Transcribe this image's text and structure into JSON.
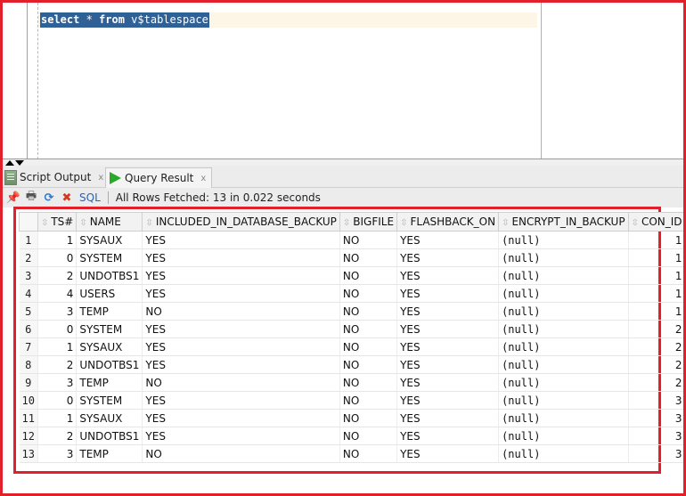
{
  "editor": {
    "sql_keyword_select": "select",
    "sql_star": " * ",
    "sql_keyword_from": "from",
    "sql_object": " v$tablespace"
  },
  "tabs": [
    {
      "label": "Script Output",
      "close": "x",
      "icon": "script-output-icon"
    },
    {
      "label": "Query Result",
      "close": "x",
      "icon": "play-icon",
      "active": true
    }
  ],
  "toolbar": {
    "pin_icon": "📌",
    "print_icon": "🖶",
    "refresh_icon": "⟳",
    "cancel_icon": "✖",
    "sql_label": "SQL",
    "status": "All Rows Fetched: 13 in 0.022 seconds"
  },
  "grid": {
    "sort_glyph": "⇳",
    "columns": [
      "TS#",
      "NAME",
      "INCLUDED_IN_DATABASE_BACKUP",
      "BIGFILE",
      "FLASHBACK_ON",
      "ENCRYPT_IN_BACKUP",
      "CON_ID"
    ],
    "rows": [
      {
        "n": "1",
        "ts": "1",
        "name": "SYSAUX",
        "inc": "YES",
        "big": "NO",
        "fb": "YES",
        "enc": "(null)",
        "con": "1"
      },
      {
        "n": "2",
        "ts": "0",
        "name": "SYSTEM",
        "inc": "YES",
        "big": "NO",
        "fb": "YES",
        "enc": "(null)",
        "con": "1"
      },
      {
        "n": "3",
        "ts": "2",
        "name": "UNDOTBS1",
        "inc": "YES",
        "big": "NO",
        "fb": "YES",
        "enc": "(null)",
        "con": "1"
      },
      {
        "n": "4",
        "ts": "4",
        "name": "USERS",
        "inc": "YES",
        "big": "NO",
        "fb": "YES",
        "enc": "(null)",
        "con": "1"
      },
      {
        "n": "5",
        "ts": "3",
        "name": "TEMP",
        "inc": "NO",
        "big": "NO",
        "fb": "YES",
        "enc": "(null)",
        "con": "1"
      },
      {
        "n": "6",
        "ts": "0",
        "name": "SYSTEM",
        "inc": "YES",
        "big": "NO",
        "fb": "YES",
        "enc": "(null)",
        "con": "2"
      },
      {
        "n": "7",
        "ts": "1",
        "name": "SYSAUX",
        "inc": "YES",
        "big": "NO",
        "fb": "YES",
        "enc": "(null)",
        "con": "2"
      },
      {
        "n": "8",
        "ts": "2",
        "name": "UNDOTBS1",
        "inc": "YES",
        "big": "NO",
        "fb": "YES",
        "enc": "(null)",
        "con": "2"
      },
      {
        "n": "9",
        "ts": "3",
        "name": "TEMP",
        "inc": "NO",
        "big": "NO",
        "fb": "YES",
        "enc": "(null)",
        "con": "2"
      },
      {
        "n": "10",
        "ts": "0",
        "name": "SYSTEM",
        "inc": "YES",
        "big": "NO",
        "fb": "YES",
        "enc": "(null)",
        "con": "3"
      },
      {
        "n": "11",
        "ts": "1",
        "name": "SYSAUX",
        "inc": "YES",
        "big": "NO",
        "fb": "YES",
        "enc": "(null)",
        "con": "3"
      },
      {
        "n": "12",
        "ts": "2",
        "name": "UNDOTBS1",
        "inc": "YES",
        "big": "NO",
        "fb": "YES",
        "enc": "(null)",
        "con": "3"
      },
      {
        "n": "13",
        "ts": "3",
        "name": "TEMP",
        "inc": "NO",
        "big": "NO",
        "fb": "YES",
        "enc": "(null)",
        "con": "3"
      }
    ]
  },
  "colors": {
    "highlight_frame": "#e2202c",
    "selection": "#2f6196",
    "sql_link": "#2763b8",
    "play": "#2aa82a"
  }
}
